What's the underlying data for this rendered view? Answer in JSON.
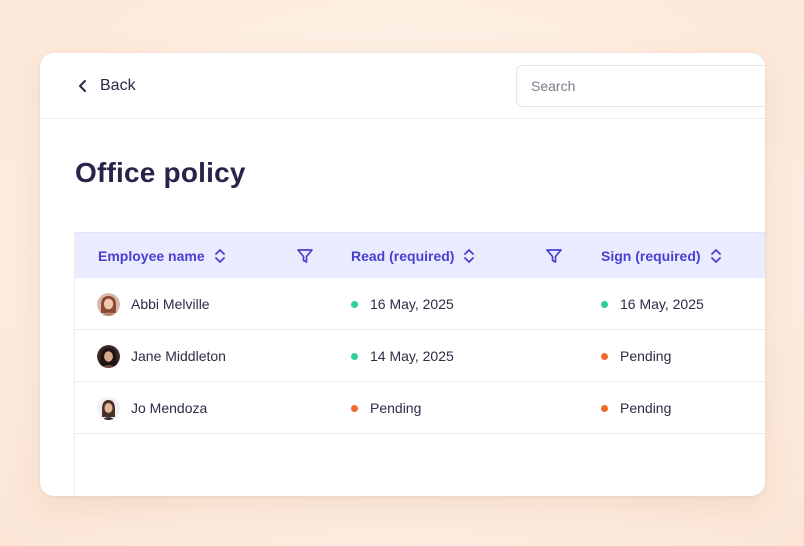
{
  "header": {
    "back_label": "Back",
    "search_placeholder": "Search"
  },
  "page": {
    "title": "Office policy"
  },
  "table": {
    "columns": [
      {
        "label": "Employee name"
      },
      {
        "label": "Read (required)"
      },
      {
        "label": "Sign (required)"
      }
    ],
    "rows": [
      {
        "name": "Abbi Melville",
        "read": "16 May, 2025",
        "read_status": "done",
        "sign": "16 May, 2025",
        "sign_status": "done"
      },
      {
        "name": "Jane Middleton",
        "read": "14 May, 2025",
        "read_status": "done",
        "sign": "Pending",
        "sign_status": "pending"
      },
      {
        "name": "Jo Mendoza",
        "read": "Pending",
        "read_status": "pending",
        "sign": "Pending",
        "sign_status": "pending"
      }
    ]
  },
  "colors": {
    "accent": "#4a3fd1",
    "header_bg": "#e9ebff",
    "done": "#2fcf96",
    "pending": "#f26a2a"
  }
}
